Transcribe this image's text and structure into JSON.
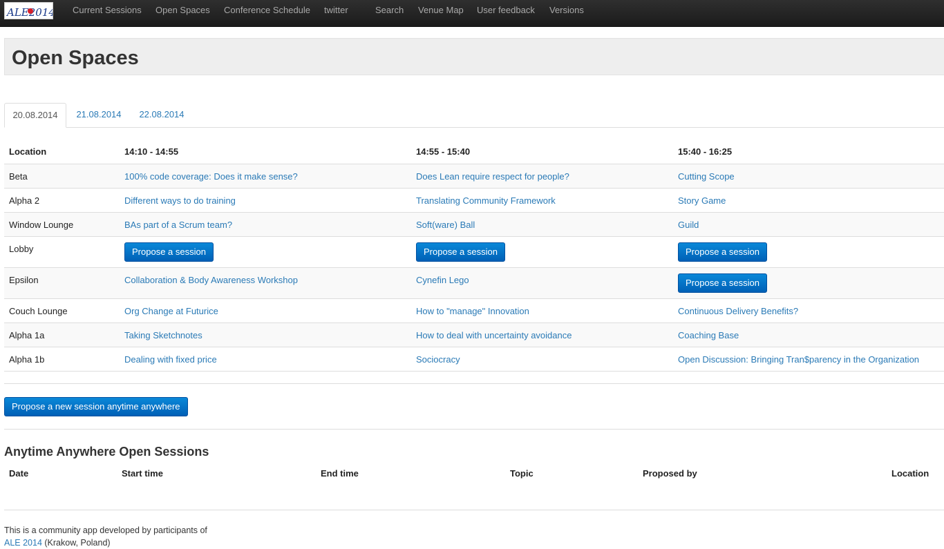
{
  "logo": {
    "text": "ALE2014"
  },
  "nav": {
    "items": [
      "Current Sessions",
      "Open Spaces",
      "Conference Schedule",
      "twitter",
      "Search",
      "Venue Map",
      "User feedback",
      "Versions"
    ]
  },
  "page": {
    "title": "Open Spaces"
  },
  "tabs": [
    "20.08.2014",
    "21.08.2014",
    "22.08.2014"
  ],
  "active_tab": "20.08.2014",
  "schedule": {
    "location_header": "Location",
    "slots": [
      "14:10 - 14:55",
      "14:55 - 15:40",
      "15:40 - 16:25"
    ],
    "rows": [
      {
        "location": "Beta",
        "sessions": [
          "100% code coverage: Does it make sense?",
          "Does Lean require respect for people?",
          "Cutting Scope"
        ]
      },
      {
        "location": "Alpha 2",
        "sessions": [
          "Different ways to do training",
          "Translating Community Framework",
          "Story Game"
        ]
      },
      {
        "location": "Window Lounge",
        "sessions": [
          "BAs part of a Scrum team?",
          "Soft(ware) Ball",
          "Guild"
        ]
      },
      {
        "location": "Lobby",
        "sessions": [
          "",
          "",
          ""
        ]
      },
      {
        "location": "Epsilon",
        "sessions": [
          "Collaboration & Body Awareness Workshop",
          "Cynefin Lego",
          ""
        ]
      },
      {
        "location": "Couch Lounge",
        "sessions": [
          "Org Change at Futurice",
          "How to \"manage\" Innovation",
          "Continuous Delivery Benefits?"
        ]
      },
      {
        "location": "Alpha 1a",
        "sessions": [
          "Taking Sketchnotes",
          "How to deal with uncertainty avoidance",
          "Coaching Base"
        ]
      },
      {
        "location": "Alpha 1b",
        "sessions": [
          "Dealing with fixed price",
          "Sociocracy",
          "Open Discussion: Bringing Tran$parency in the Organization"
        ]
      }
    ],
    "propose_label": "Propose a session"
  },
  "propose_anytime_label": "Propose a new session anytime anywhere",
  "anytime": {
    "title": "Anytime Anywhere Open Sessions",
    "headers": [
      "Date",
      "Start time",
      "End time",
      "Topic",
      "Proposed by",
      "Location"
    ]
  },
  "footer": {
    "line1": "This is a community app developed by participants of",
    "link": "ALE 2014",
    "suffix": " (Krakow, Poland)"
  },
  "colors": {
    "link": "#2a7ab6",
    "button": "#0a7ad0",
    "navbar": "#222222"
  }
}
